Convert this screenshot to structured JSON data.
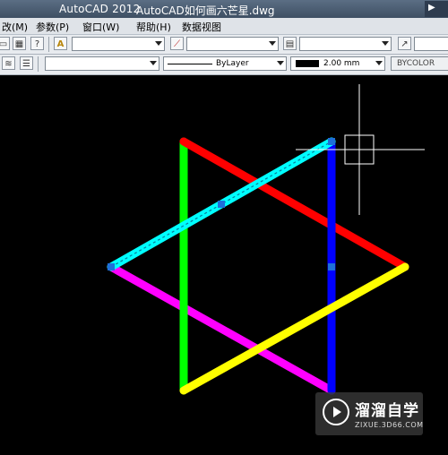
{
  "window": {
    "app_title": "AutoCAD 2012",
    "file_title": "AutoCAD如何画六芒星.dwg"
  },
  "menubar": {
    "items": [
      "改(M)",
      "参数(P)",
      "窗口(W)",
      "帮助(H)",
      "数据视图"
    ]
  },
  "toolbar1": {
    "text_style_value": "",
    "dim_style_value": "",
    "table_style_value": "",
    "multileader_style_value": ""
  },
  "toolbar2": {
    "layer_value": "",
    "linetype_value": "ByLayer",
    "lineweight_value": "2.00 mm",
    "plotstyle_value": "BYCOLOR"
  },
  "drawing": {
    "lines": [
      {
        "name": "red-line",
        "color": "#ff0000"
      },
      {
        "name": "green-line",
        "color": "#00ff00"
      },
      {
        "name": "blue-line",
        "color": "#0000ff"
      },
      {
        "name": "yellow-line",
        "color": "#ffff00"
      },
      {
        "name": "magenta-line",
        "color": "#ff00ff"
      },
      {
        "name": "cyan-line",
        "color": "#00ffff"
      }
    ],
    "grip_color": "#1e6fd9"
  },
  "watermark": {
    "brand": "溜溜自学",
    "url": "ZIXUE.3D66.COM"
  }
}
